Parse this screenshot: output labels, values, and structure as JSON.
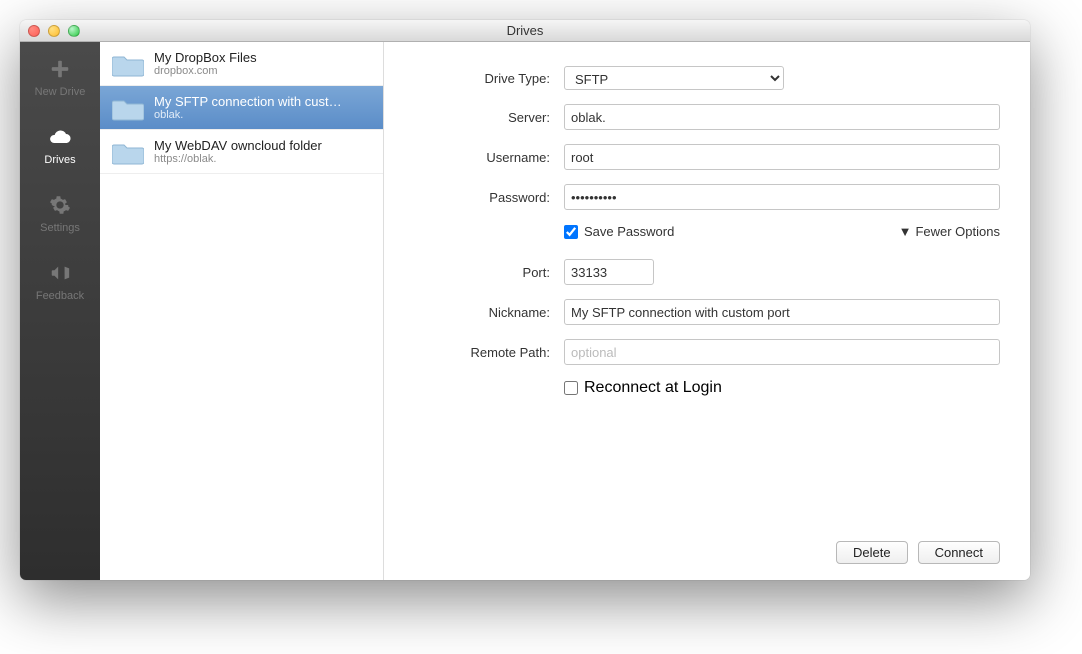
{
  "window": {
    "title": "Drives"
  },
  "sidebar": {
    "items": [
      {
        "label": "New Drive",
        "icon": "plus-icon"
      },
      {
        "label": "Drives",
        "icon": "cloud-icon"
      },
      {
        "label": "Settings",
        "icon": "gear-icon"
      },
      {
        "label": "Feedback",
        "icon": "megaphone-icon"
      }
    ],
    "active_index": 1
  },
  "drives": [
    {
      "title": "My DropBox Files",
      "subtitle": "dropbox.com"
    },
    {
      "title": "My SFTP connection with cust…",
      "subtitle": "oblak."
    },
    {
      "title": "My WebDAV owncloud folder",
      "subtitle": "https://oblak."
    }
  ],
  "selected_drive_index": 1,
  "form": {
    "labels": {
      "drive_type": "Drive Type:",
      "server": "Server:",
      "username": "Username:",
      "password": "Password:",
      "save_password": "Save Password",
      "fewer_options": "Fewer Options",
      "port": "Port:",
      "nickname": "Nickname:",
      "remote_path": "Remote Path:",
      "reconnect": "Reconnect at Login"
    },
    "drive_type_options": [
      "SFTP"
    ],
    "drive_type": "SFTP",
    "server": "oblak.",
    "username": "root",
    "password": "••••••••••",
    "save_password_checked": true,
    "port": "33133",
    "nickname": "My SFTP connection with custom port",
    "remote_path": "",
    "remote_path_placeholder": "optional",
    "reconnect_checked": false
  },
  "buttons": {
    "delete": "Delete",
    "connect": "Connect"
  }
}
